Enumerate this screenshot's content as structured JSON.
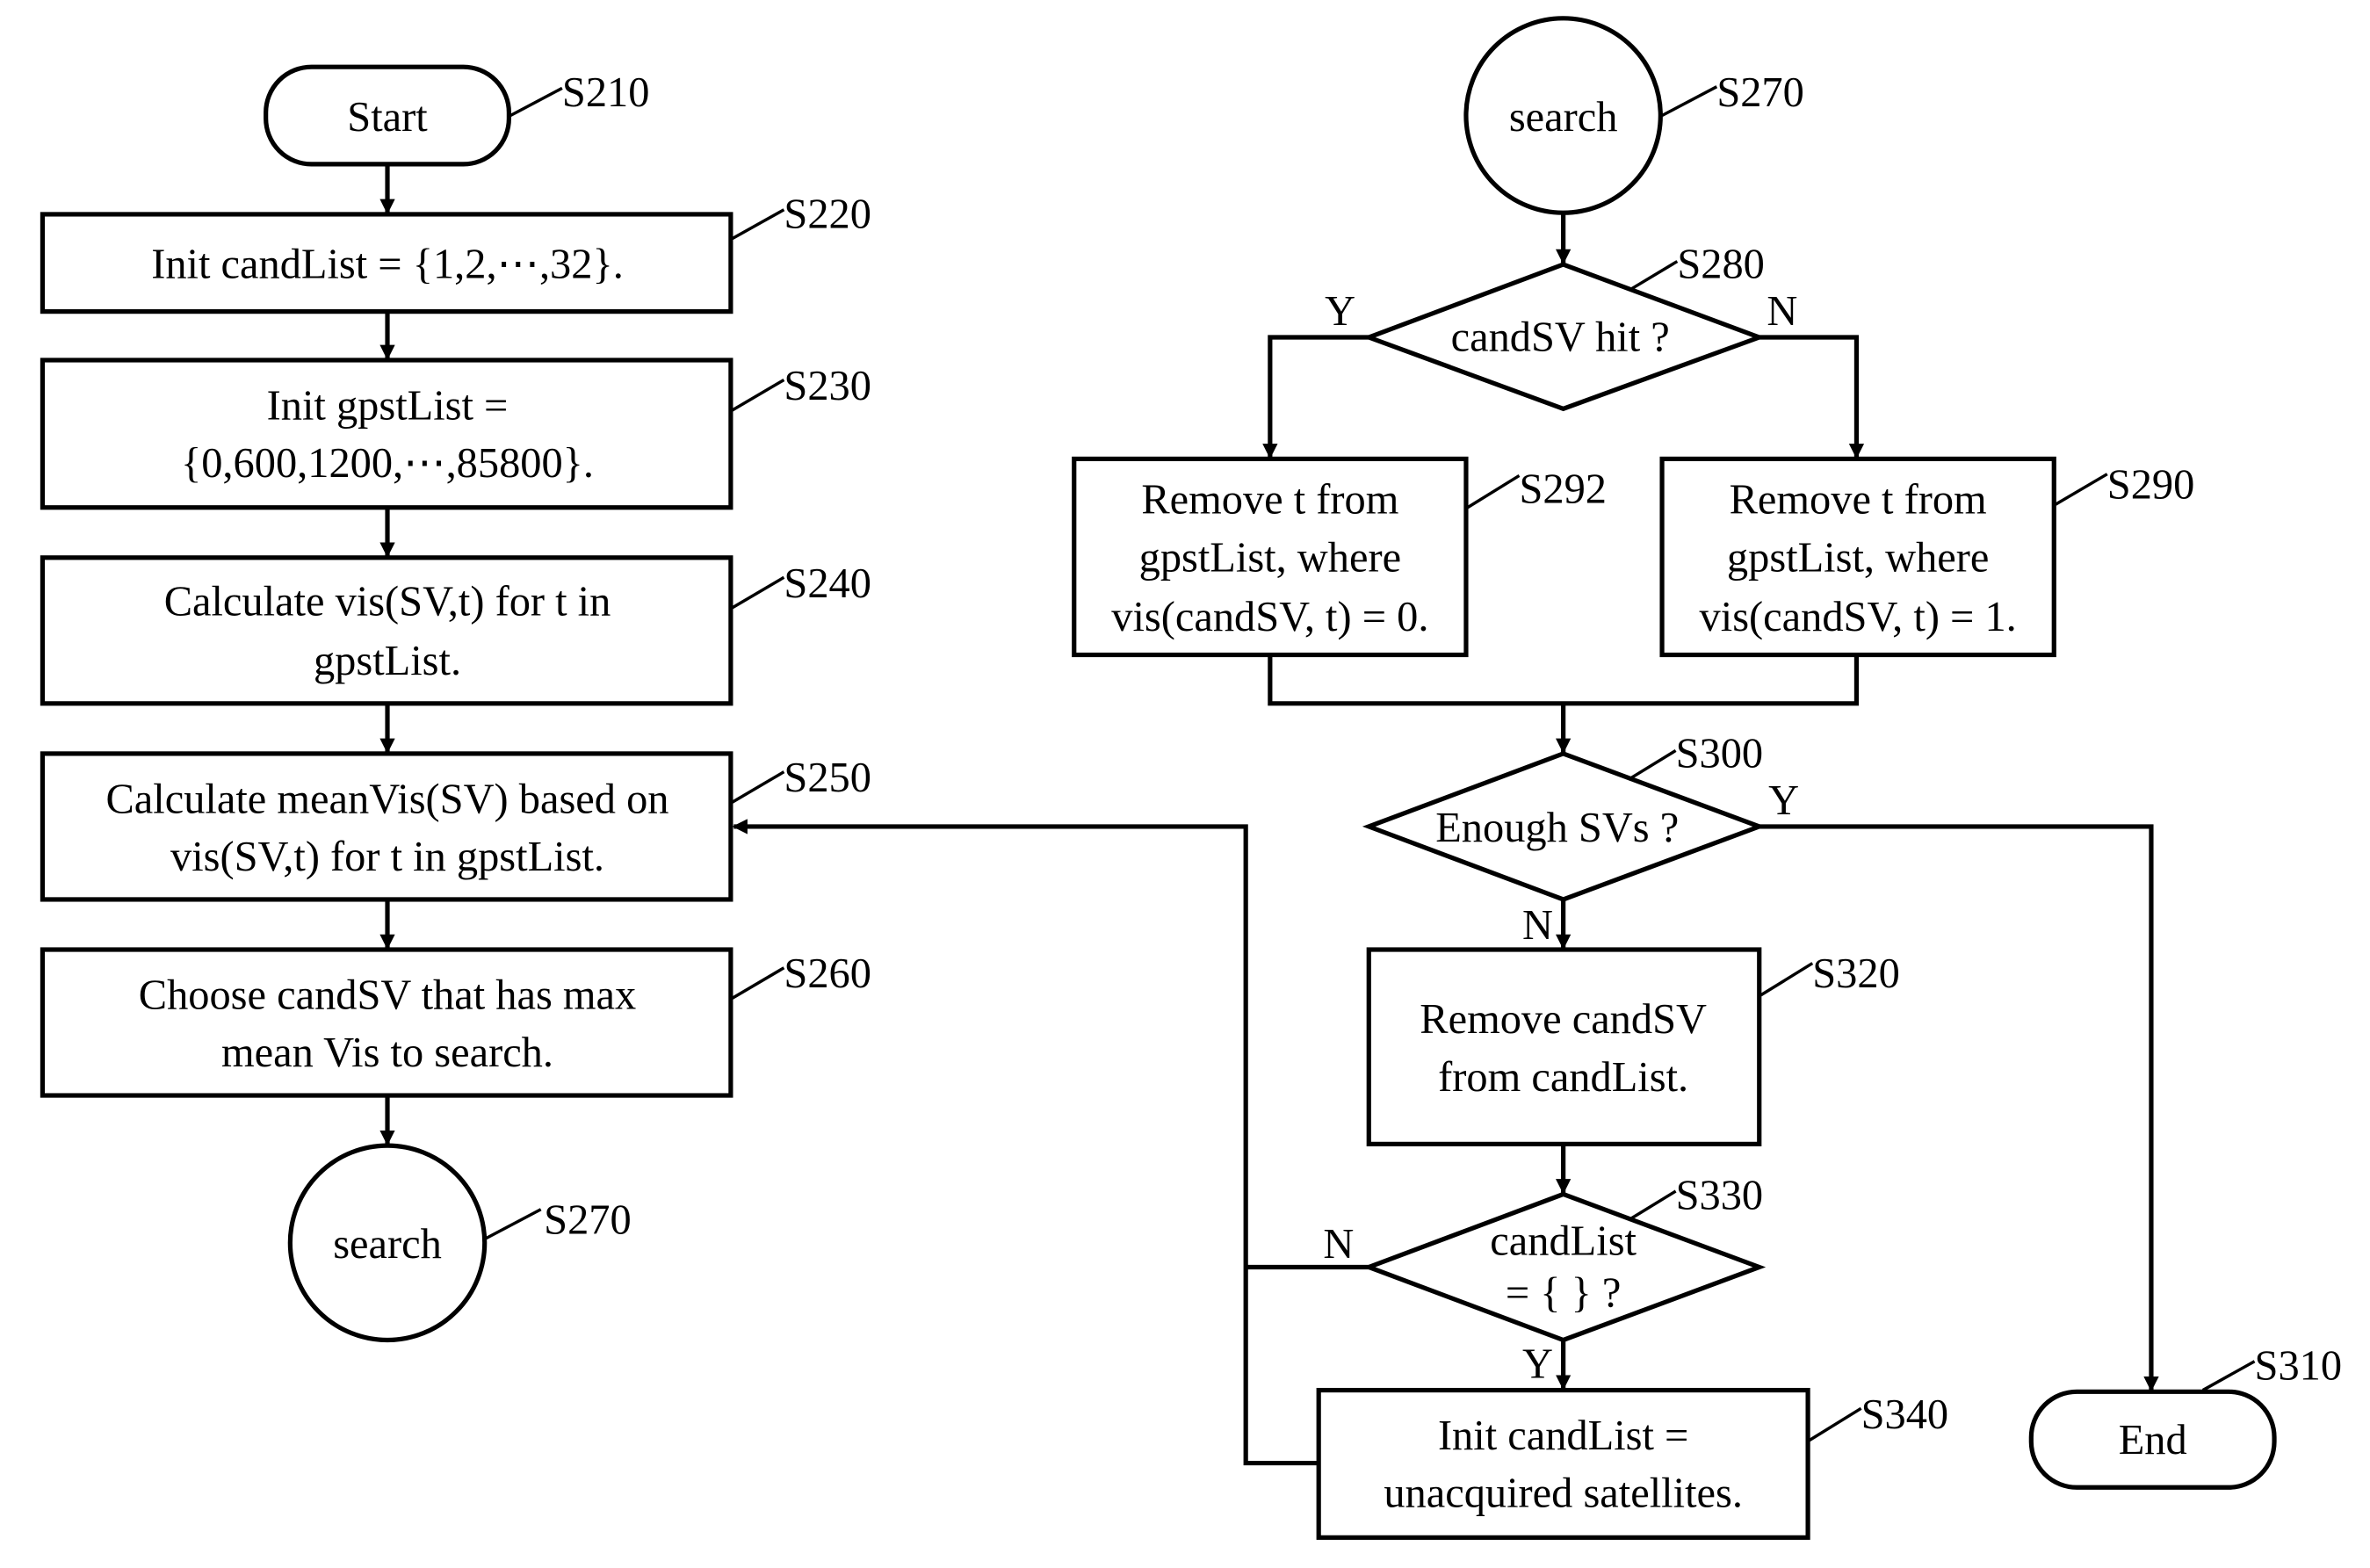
{
  "diagram": {
    "type": "flowchart",
    "left_column": {
      "start": {
        "text": "Start",
        "step": "S210"
      },
      "s220": {
        "lines": [
          "Init candList = {1,2,⋯,32}."
        ],
        "step": "S220"
      },
      "s230": {
        "lines": [
          "Init gpstList =",
          "{0,600,1200,⋯,85800}."
        ],
        "step": "S230"
      },
      "s240": {
        "lines": [
          "Calculate vis(SV,t) for t in",
          "gpstList."
        ],
        "step": "S240"
      },
      "s250": {
        "lines": [
          "Calculate meanVis(SV) based on",
          "vis(SV,t) for t in gpstList."
        ],
        "step": "S250"
      },
      "s260": {
        "lines": [
          "Choose candSV that has max",
          "mean Vis to search."
        ],
        "step": "S260"
      },
      "search_connector": {
        "text": "search",
        "step": "S270"
      }
    },
    "right_column": {
      "search_connector": {
        "text": "search",
        "step": "S270"
      },
      "s280": {
        "text": "candSV hit ?",
        "step": "S280",
        "yes": "Y",
        "no": "N"
      },
      "s292": {
        "lines": [
          "Remove t from",
          "gpstList, where",
          "vis(candSV, t) = 0."
        ],
        "step": "S292"
      },
      "s290": {
        "lines": [
          "Remove t from",
          "gpstList, where",
          "vis(candSV, t) = 1."
        ],
        "step": "S290"
      },
      "s300": {
        "text": "Enough SVs ?",
        "step": "S300",
        "yes": "Y",
        "no": "N"
      },
      "s320": {
        "lines": [
          "Remove candSV",
          "from candList."
        ],
        "step": "S320"
      },
      "s330": {
        "lines": [
          "candList",
          "= { } ?"
        ],
        "step": "S330",
        "yes": "Y",
        "no": "N"
      },
      "s340": {
        "lines": [
          "Init candList =",
          "unacquired satellites."
        ],
        "step": "S340"
      },
      "end": {
        "text": "End",
        "step": "S310"
      }
    }
  }
}
